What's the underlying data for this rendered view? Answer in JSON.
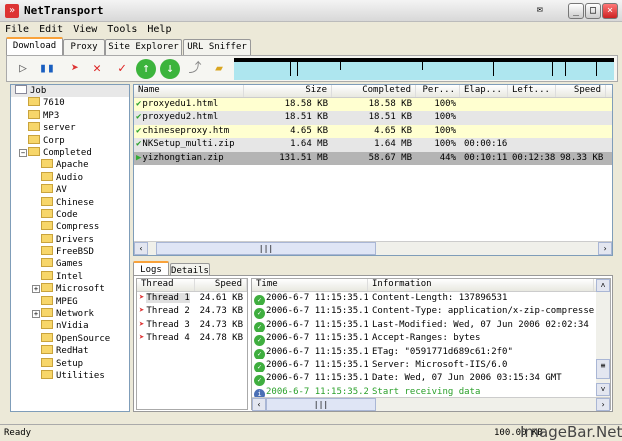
{
  "window": {
    "title": "NetTransport"
  },
  "menu": [
    "File",
    "Edit",
    "View",
    "Tools",
    "Help"
  ],
  "tabs": [
    "Download",
    "Proxy",
    "Site Explorer",
    "URL Sniffer"
  ],
  "tree": [
    "Job",
    "7610",
    "MP3",
    "server",
    "Corp",
    "Completed",
    "Apache",
    "Audio",
    "AV",
    "Chinese",
    "Code",
    "Compress",
    "Drivers",
    "FreeBSD",
    "Games",
    "Intel",
    "Microsoft",
    "MPEG",
    "Network",
    "nVidia",
    "OpenSource",
    "RedHat",
    "Setup",
    "Utilities"
  ],
  "list": {
    "headers": [
      "Name",
      "Size",
      "Completed",
      "Per...",
      "Elap...",
      "Left...",
      "Speed"
    ],
    "rows": [
      [
        "proxyedu1.html",
        "18.58 KB",
        "18.58 KB",
        "100%",
        "",
        "",
        ""
      ],
      [
        "proxyedu2.html",
        "18.51 KB",
        "18.51 KB",
        "100%",
        "",
        "",
        ""
      ],
      [
        "chineseproxy.htm",
        "4.65 KB",
        "4.65 KB",
        "100%",
        "",
        "",
        ""
      ],
      [
        "NKSetup_multi.zip",
        "1.64 MB",
        "1.64 MB",
        "100%",
        "00:00:16",
        "",
        ""
      ],
      [
        "yizhongtian.zip",
        "131.51 MB",
        "58.67 MB",
        "44%",
        "00:10:11",
        "00:12:38",
        "98.33 KB"
      ]
    ]
  },
  "bottom_tabs": [
    "Logs",
    "Details"
  ],
  "threads": {
    "headers": [
      "Thread",
      "Speed"
    ],
    "rows": [
      [
        "Thread 1",
        "24.61 KB"
      ],
      [
        "Thread 2",
        "24.73 KB"
      ],
      [
        "Thread 3",
        "24.73 KB"
      ],
      [
        "Thread 4",
        "24.78 KB"
      ]
    ]
  },
  "log": {
    "headers": [
      "Time",
      "Information"
    ],
    "rows": [
      [
        "2006-6-7 11:15:35.140",
        "Content-Length: 137896531"
      ],
      [
        "2006-6-7 11:15:35.140",
        "Content-Type: application/x-zip-compressed"
      ],
      [
        "2006-6-7 11:15:35.140",
        "Last-Modified: Wed, 07 Jun 2006 02:02:34 GMT"
      ],
      [
        "2006-6-7 11:15:35.140",
        "Accept-Ranges: bytes"
      ],
      [
        "2006-6-7 11:15:35.140",
        "ETag: \"0591771d689c61:2f0\""
      ],
      [
        "2006-6-7 11:15:35.140",
        "Server: Microsoft-IIS/6.0"
      ],
      [
        "2006-6-7 11:15:35.140",
        "Date: Wed, 07 Jun 2006 03:15:34 GMT"
      ],
      [
        "2006-6-7 11:15:35.203",
        "Start receiving data"
      ]
    ]
  },
  "status": {
    "text": "Ready",
    "speed": "100.00 KB",
    "watermark": "ImageBar.Net"
  },
  "colors": {
    "row_yellow": "#ffffd0",
    "row_gray": "#e6e6e6",
    "selected": "#b4b4b4",
    "graph": "#aee6ef",
    "info_green": "#2aa02a"
  }
}
